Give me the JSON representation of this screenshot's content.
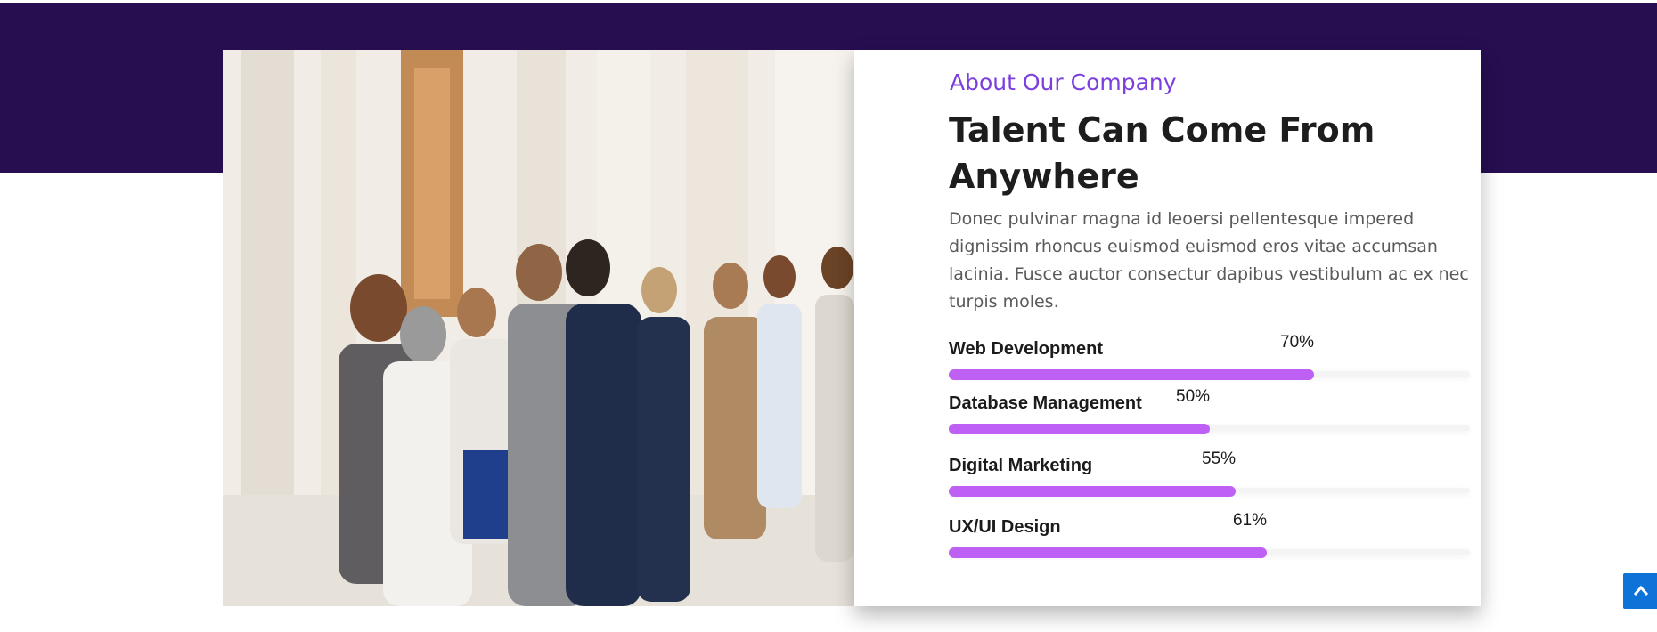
{
  "about": {
    "eyebrow": "About Our Company",
    "title": "Talent Can Come From Anywhere",
    "description": "Donec pulvinar magna id leoersi pellentesque impered dignissim rhoncus euismod euismod eros vitae accumsan lacinia. Fusce auctor consectur dapibus vestibulum ac ex nec turpis moles."
  },
  "skills": [
    {
      "label": "Web Development",
      "percent_text": "70%",
      "value": 0.7
    },
    {
      "label": "Database Management",
      "percent_text": "50%",
      "value": 0.5
    },
    {
      "label": "Digital Marketing",
      "percent_text": "55%",
      "value": 0.55
    },
    {
      "label": "UX/UI Design",
      "percent_text": "61%",
      "value": 0.61
    }
  ],
  "colors": {
    "band": "#260e51",
    "accent": "#7b3fe0",
    "bar_fill": "#bd60f3",
    "scroll_button": "#0d73d9"
  },
  "scroll_top": {
    "icon": "chevron-up-icon"
  }
}
